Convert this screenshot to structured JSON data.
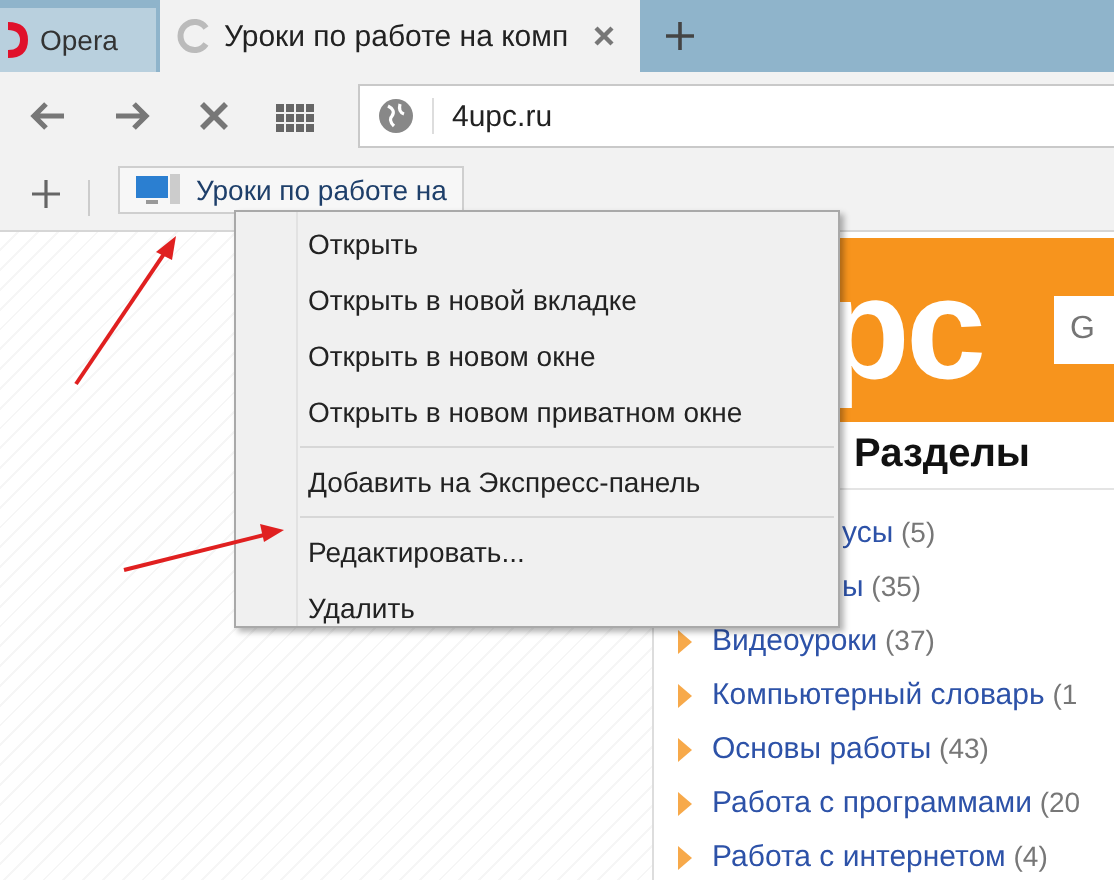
{
  "tabs": [
    {
      "kind": "browser",
      "label": "Opera",
      "selected": false
    },
    {
      "kind": "page",
      "label": "Уроки по работе на комп",
      "selected": true
    }
  ],
  "address_bar": {
    "value": "4upc.ru"
  },
  "bookmarks": [
    {
      "label": "Уроки по работе на"
    }
  ],
  "page": {
    "logo_text": "pc",
    "search_placeholder": "G",
    "heading": "Разделы",
    "sections": [
      {
        "kind": "covered",
        "label": "усы",
        "count": "(5)"
      },
      {
        "kind": "covered",
        "label": "ы",
        "count": "(35)"
      },
      {
        "kind": "full",
        "label": "Видеоуроки",
        "count": "(37)"
      },
      {
        "kind": "full",
        "label": "Компьютерный словарь",
        "count": "(1"
      },
      {
        "kind": "full",
        "label": "Основы работы",
        "count": "(43)"
      },
      {
        "kind": "full",
        "label": "Работа с программами",
        "count": "(20"
      },
      {
        "kind": "full",
        "label": "Работа с интернетом",
        "count": "(4)"
      }
    ]
  },
  "context_menu": {
    "groups": [
      [
        "Открыть",
        "Открыть в новой вкладке",
        "Открыть в новом окне",
        "Открыть в новом приватном окне"
      ],
      [
        "Добавить на Экспресс-панель"
      ],
      [
        "Редактировать...",
        "Удалить"
      ]
    ]
  }
}
